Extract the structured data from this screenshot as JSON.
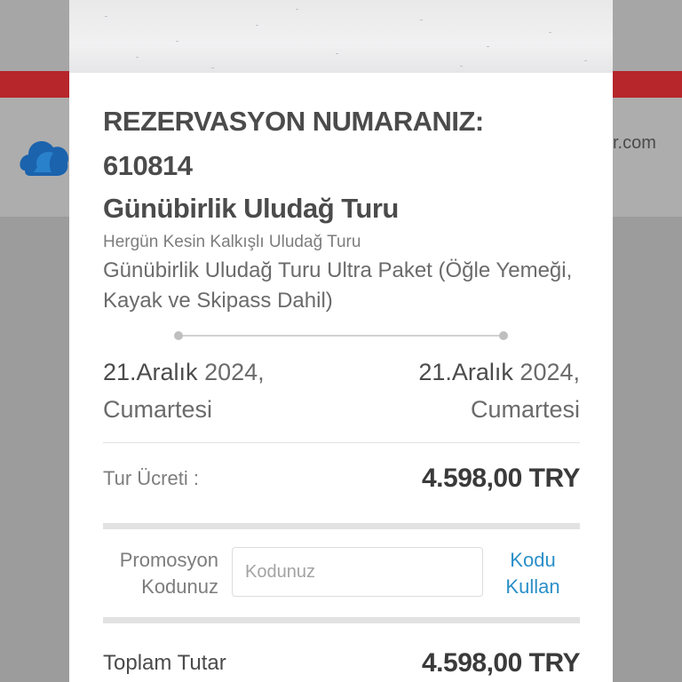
{
  "background": {
    "domain_fragment": "r.com",
    "brand_color": "#b6262a"
  },
  "reservation": {
    "title_line1": "REZERVASYON NUMARANIZ:",
    "number": "610814",
    "tour_name": "Günübirlik Uludağ Turu",
    "tour_subtitle": "Hergün Kesin Kalkışlı Uludağ Turu",
    "package": "Günübirlik Uludağ Turu Ultra Paket (Öğle Yemeği, Kayak ve Skipass Dahil)"
  },
  "dates": {
    "start": {
      "date": "21.Aralık",
      "year": "2024,",
      "weekday": "Cumartesi"
    },
    "end": {
      "date": "21.Aralık",
      "year": "2024,",
      "weekday": "Cumartesi"
    }
  },
  "pricing": {
    "fee_label": "Tur Ücreti :",
    "fee_value": "4.598,00 TRY",
    "total_label": "Toplam Tutar",
    "total_value": "4.598,00 TRY"
  },
  "promo": {
    "label": "Promosyon Kodunuz",
    "placeholder": "Kodunuz",
    "value": "",
    "button_label": "Kodu Kullan",
    "link_color": "#2a8fc8"
  }
}
